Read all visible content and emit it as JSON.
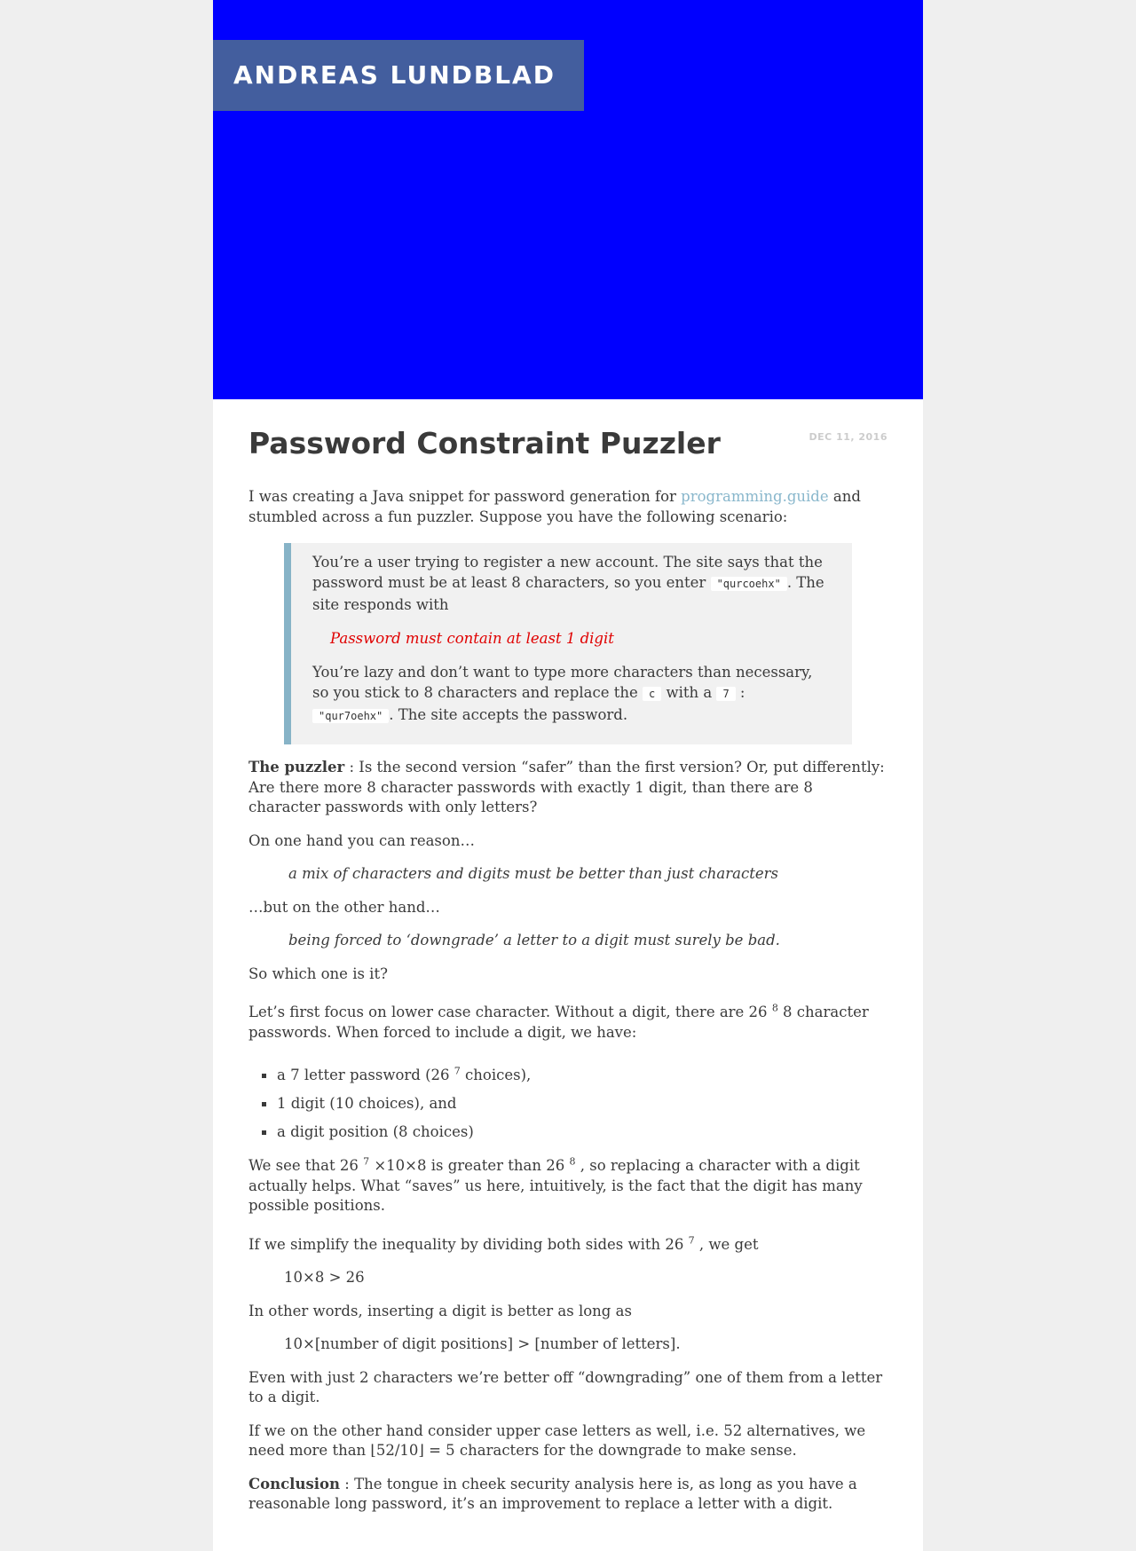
{
  "site": {
    "title": "ANDREAS LUNDBLAD"
  },
  "post": {
    "title": "Password Constraint Puzzler",
    "date": "DEC 11, 2016",
    "intro_1": "I was creating a Java snippet for password generation for ",
    "intro_link": "programming.guide",
    "intro_2": " and stumbled across a fun puzzler. Suppose you have the following scenario:",
    "callout": {
      "p1_a": "You’re a user trying to register a new account. The site says that the password must be at least 8 characters, so you enter ",
      "p1_code": "\"qurcoehx\"",
      "p1_b": ". The site responds with",
      "warning": "Password must contain at least 1 digit",
      "p2_a": "You’re lazy and don’t want to type more characters than necessary, so you stick to 8 characters and replace the ",
      "p2_code1": "c",
      "p2_b": " with a ",
      "p2_code2": "7",
      "p2_c": " : ",
      "p2_code3": "\"qur7oehx\"",
      "p2_d": ". The site accepts the password."
    },
    "puzzler_label": "The puzzler",
    "puzzler_text": " : Is the second version “safer” than the first version? Or, put differently: Are there more 8 character passwords with exactly 1 digit, than there are 8 character passwords with only letters?",
    "reason_intro": "On one hand you can reason…",
    "quote_1": "a mix of characters and digits must be better than just characters",
    "other_hand": "…but on the other hand…",
    "quote_2": "being forced to ‘downgrade’ a letter to a digit must surely be bad.",
    "which": "So which one is it?",
    "focus_a": "Let’s first focus on lower case character. Without a digit, there are 26 ",
    "focus_sup": "8",
    "focus_b": " 8 character passwords. When forced to include a digit, we have:",
    "list": [
      {
        "a": "a 7 letter password (26 ",
        "sup": "7",
        "b": " choices),"
      },
      {
        "a": "1 digit (10 choices), and",
        "sup": "",
        "b": ""
      },
      {
        "a": "a digit position (8 choices)",
        "sup": "",
        "b": ""
      }
    ],
    "see_a": "We see that 26 ",
    "see_sup1": "7",
    "see_b": " ×10×8 is greater than 26 ",
    "see_sup2": "8",
    "see_c": " , so replacing a character with a digit actually helps. What “saves” us here, intuitively, is the fact that the digit has many possible positions.",
    "simplify_a": "If we simplify the inequality by dividing both sides with 26 ",
    "simplify_sup": "7",
    "simplify_b": " , we get",
    "ineq_1": "10×8 > 26",
    "other_words": "In other words, inserting a digit is better as long as",
    "ineq_2": "10×[number of digit positions] > [number of letters].",
    "even": "Even with just 2 characters we’re better off “downgrading” one of them from a letter to a digit.",
    "upper": "If we on the other hand consider upper case letters as well, i.e. 52 alternatives, we need more than ⌊52/10⌋ = 5 characters for the downgrade to make sense.",
    "conclusion_label": "Conclusion",
    "conclusion_text": " : The tongue in cheek security analysis here is, as long as you have a reasonable long password, it’s an improvement to replace a letter with a digit."
  }
}
